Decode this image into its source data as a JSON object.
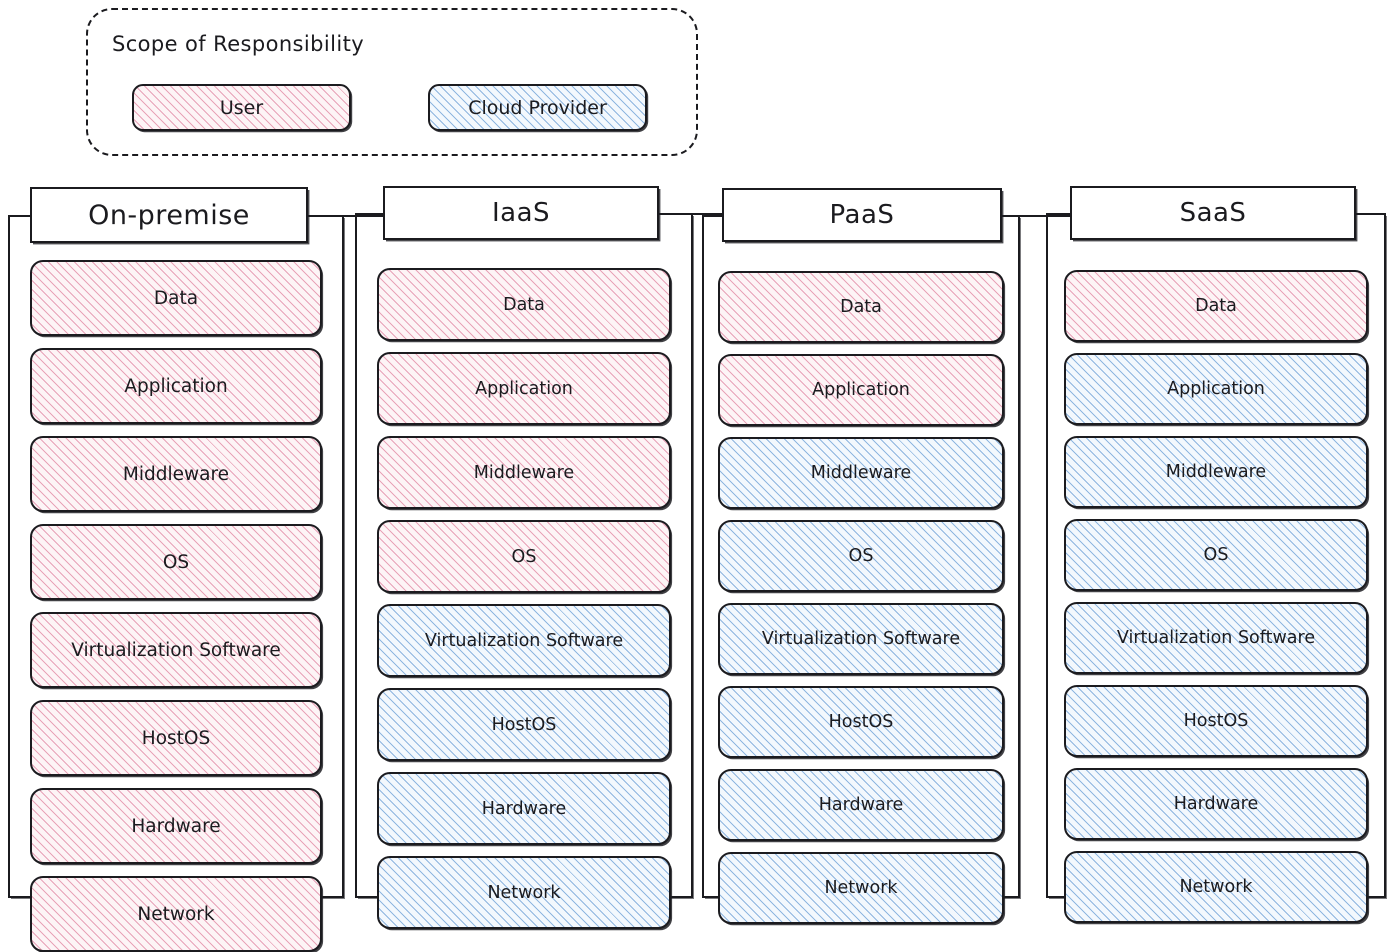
{
  "legend": {
    "title": "Scope of Responsibility",
    "items": [
      {
        "label": "User",
        "fill": "pink",
        "color": "#e8a3b8"
      },
      {
        "label": "Cloud Provider",
        "fill": "blue",
        "color": "#8fb6e0"
      }
    ]
  },
  "layer_names": [
    "Data",
    "Application",
    "Middleware",
    "OS",
    "Virtualization Software",
    "HostOS",
    "Hardware",
    "Network"
  ],
  "columns": [
    {
      "title": "On-premise",
      "layers": [
        {
          "label": "Data",
          "owner": "User",
          "fill": "pink"
        },
        {
          "label": "Application",
          "owner": "User",
          "fill": "pink"
        },
        {
          "label": "Middleware",
          "owner": "User",
          "fill": "pink"
        },
        {
          "label": "OS",
          "owner": "User",
          "fill": "pink"
        },
        {
          "label": "Virtualization Software",
          "owner": "User",
          "fill": "pink"
        },
        {
          "label": "HostOS",
          "owner": "User",
          "fill": "pink"
        },
        {
          "label": "Hardware",
          "owner": "User",
          "fill": "pink"
        },
        {
          "label": "Network",
          "owner": "User",
          "fill": "pink"
        }
      ]
    },
    {
      "title": "IaaS",
      "layers": [
        {
          "label": "Data",
          "owner": "User",
          "fill": "pink"
        },
        {
          "label": "Application",
          "owner": "User",
          "fill": "pink"
        },
        {
          "label": "Middleware",
          "owner": "User",
          "fill": "pink"
        },
        {
          "label": "OS",
          "owner": "User",
          "fill": "pink"
        },
        {
          "label": "Virtualization Software",
          "owner": "Cloud Provider",
          "fill": "blue"
        },
        {
          "label": "HostOS",
          "owner": "Cloud Provider",
          "fill": "blue"
        },
        {
          "label": "Hardware",
          "owner": "Cloud Provider",
          "fill": "blue"
        },
        {
          "label": "Network",
          "owner": "Cloud Provider",
          "fill": "blue"
        }
      ]
    },
    {
      "title": "PaaS",
      "layers": [
        {
          "label": "Data",
          "owner": "User",
          "fill": "pink"
        },
        {
          "label": "Application",
          "owner": "User",
          "fill": "pink"
        },
        {
          "label": "Middleware",
          "owner": "Cloud Provider",
          "fill": "blue"
        },
        {
          "label": "OS",
          "owner": "Cloud Provider",
          "fill": "blue"
        },
        {
          "label": "Virtualization Software",
          "owner": "Cloud Provider",
          "fill": "blue"
        },
        {
          "label": "HostOS",
          "owner": "Cloud Provider",
          "fill": "blue"
        },
        {
          "label": "Hardware",
          "owner": "Cloud Provider",
          "fill": "blue"
        },
        {
          "label": "Network",
          "owner": "Cloud Provider",
          "fill": "blue"
        }
      ]
    },
    {
      "title": "SaaS",
      "layers": [
        {
          "label": "Data",
          "owner": "User",
          "fill": "pink"
        },
        {
          "label": "Application",
          "owner": "Cloud Provider",
          "fill": "blue"
        },
        {
          "label": "Middleware",
          "owner": "Cloud Provider",
          "fill": "blue"
        },
        {
          "label": "OS",
          "owner": "Cloud Provider",
          "fill": "blue"
        },
        {
          "label": "Virtualization Software",
          "owner": "Cloud Provider",
          "fill": "blue"
        },
        {
          "label": "HostOS",
          "owner": "Cloud Provider",
          "fill": "blue"
        },
        {
          "label": "Hardware",
          "owner": "Cloud Provider",
          "fill": "blue"
        },
        {
          "label": "Network",
          "owner": "Cloud Provider",
          "fill": "blue"
        }
      ]
    }
  ]
}
